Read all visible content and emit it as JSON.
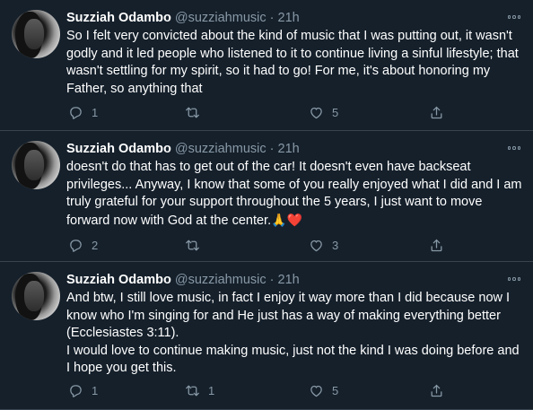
{
  "tweets": [
    {
      "name": "Suzziah Odambo",
      "handle": "@suzziahmusic",
      "separator": "·",
      "time": "21h",
      "text": "So I felt very convicted about the kind of music that I was putting out, it wasn't godly and it led people who listened to it to continue living a sinful lifestyle; that wasn't settling for my spirit, so it had to go! For me, it's about honoring my Father, so anything that",
      "replies": "1",
      "retweets": "",
      "likes": "5"
    },
    {
      "name": "Suzziah Odambo",
      "handle": "@suzziahmusic",
      "separator": "·",
      "time": "21h",
      "text": "doesn't do that has to get out of the car! It doesn't even have backseat privileges... Anyway, I know that some of you really enjoyed what I did and I am truly grateful for your support throughout the 5 years, I just want to move forward now with God at the center.",
      "emoji": "🙏❤️",
      "replies": "2",
      "retweets": "",
      "likes": "3"
    },
    {
      "name": "Suzziah Odambo",
      "handle": "@suzziahmusic",
      "separator": "·",
      "time": "21h",
      "text": "And btw, I still love music, in fact I enjoy it way more than I did because now I know who I'm singing for and He just has a way of making everything better (Ecclesiastes 3:11).\nI would love to continue making music, just not the kind I was doing before and I hope you get this.",
      "replies": "1",
      "retweets": "1",
      "likes": "5"
    }
  ],
  "colors": {
    "background": "#15202b",
    "text": "#ffffff",
    "secondary": "#8899a6",
    "divider": "#38444d"
  },
  "icons": [
    "more-icon",
    "reply-icon",
    "retweet-icon",
    "like-icon",
    "share-icon"
  ]
}
